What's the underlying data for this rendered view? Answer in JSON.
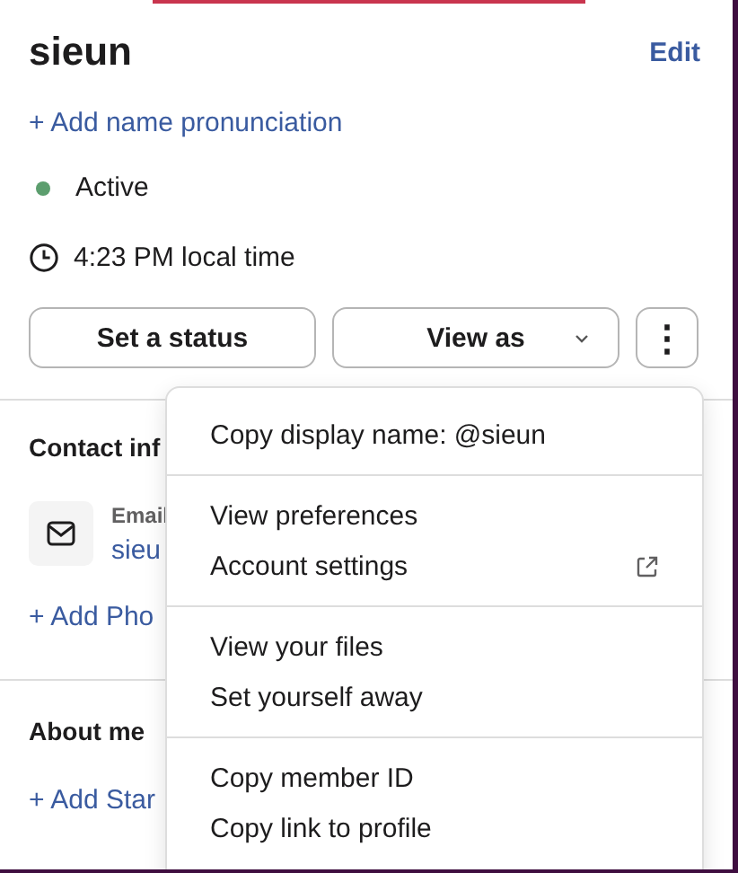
{
  "profile": {
    "name": "sieun",
    "edit_link": "Edit",
    "add_pronunciation": "+ Add name pronunciation",
    "presence": {
      "label": "Active",
      "color": "#5c9e6e"
    },
    "local_time": "4:23 PM local time"
  },
  "actions": [
    {
      "kind": "text",
      "label": "Set a status"
    },
    {
      "kind": "dropdown",
      "label": "View as"
    },
    {
      "kind": "more",
      "label": "⋮"
    }
  ],
  "contact": {
    "heading": "Contact inf",
    "email_label": "Email",
    "email_value": "sieu",
    "add_phone": "+ Add Pho"
  },
  "about": {
    "heading": "About me",
    "add_start": "+ Add Star"
  },
  "menu": {
    "sections": [
      [
        {
          "kind": "plain",
          "label": "Copy display name: @sieun"
        }
      ],
      [
        {
          "kind": "plain",
          "label": "View preferences"
        },
        {
          "kind": "external",
          "label": "Account settings"
        }
      ],
      [
        {
          "kind": "plain",
          "label": "View your files"
        },
        {
          "kind": "plain",
          "label": "Set yourself away"
        }
      ],
      [
        {
          "kind": "plain",
          "label": "Copy member ID"
        },
        {
          "kind": "plain",
          "label": "Copy link to profile"
        }
      ]
    ]
  }
}
